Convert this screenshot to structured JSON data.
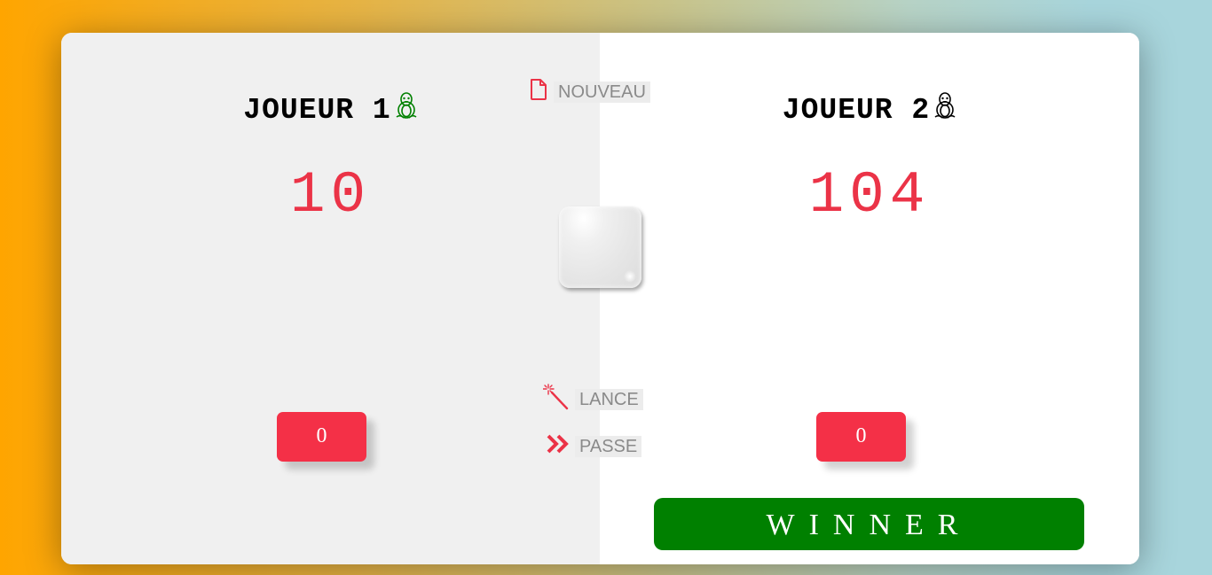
{
  "player1": {
    "name": "JOUEUR 1",
    "score": "10",
    "current": "0",
    "icon": "tux-penguin-icon",
    "icon_color": "#008000"
  },
  "player2": {
    "name": "JOUEUR 2",
    "score": "104",
    "current": "0",
    "icon": "tux-penguin-icon",
    "icon_color": "#000000",
    "winner_label": "WINNER"
  },
  "controls": {
    "new_game": {
      "label": "NOUVEAU",
      "icon": "file-icon"
    },
    "roll": {
      "label": "LANCE",
      "icon": "magic-wand-icon"
    },
    "hold": {
      "label": "PASSE",
      "icon": "double-chevron-right-icon"
    }
  },
  "colors": {
    "accent": "#f43047",
    "score": "#eb3347",
    "winner": "#008000",
    "panel_active": "#f0f0f0"
  }
}
